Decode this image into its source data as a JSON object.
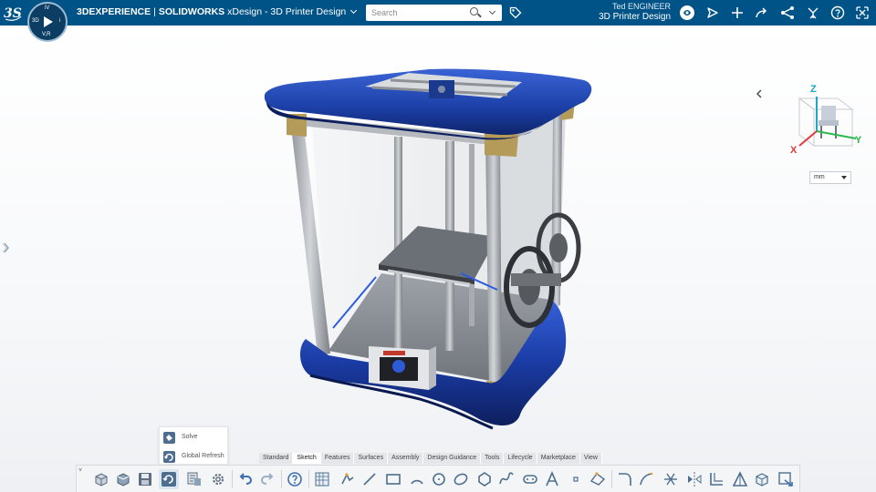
{
  "header": {
    "brand_main": "3DEXPERIENCE",
    "brand_partner": "SOLIDWORKS",
    "app_name": "xDesign - 3D Printer Design",
    "user_name": "Ted ENGINEER",
    "space_name": "3D Printer Design",
    "compass_letters": {
      "top": "iV",
      "left": "3D",
      "right": "i",
      "bottom": "V,R"
    }
  },
  "search": {
    "placeholder": "Search"
  },
  "viewport": {
    "units": "mm",
    "nav_axes": {
      "x": "X",
      "y": "Y",
      "z": "Z"
    }
  },
  "command_popup": {
    "items": [
      {
        "label": "Solve"
      },
      {
        "label": "Global Refresh"
      }
    ]
  },
  "action_bar": {
    "tabs": [
      "Standard",
      "Sketch",
      "Features",
      "Surfaces",
      "Assembly",
      "Design Guidance",
      "Tools",
      "Lifecycle",
      "Marketplace",
      "View"
    ],
    "active_tab": "Sketch",
    "collapse_glyph": "˅"
  },
  "colors": {
    "header_bg": "#005386",
    "accent_blue": "#1e49a8",
    "viewport_bg": "#f7f8fa"
  }
}
